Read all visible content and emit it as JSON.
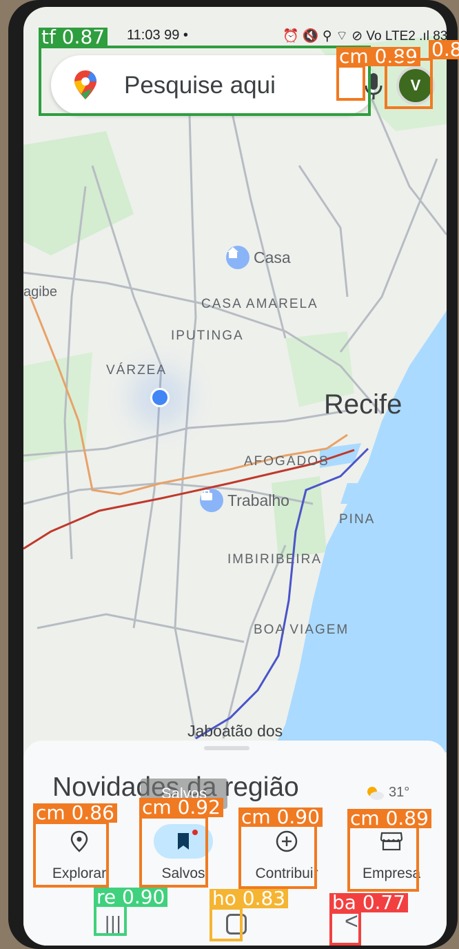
{
  "status_bar": {
    "time": "11:03 99 •",
    "icons": "⏰ 🔇 ⚲ ⌔ ⊘ Vo LTE2 .ıl 83%"
  },
  "search": {
    "placeholder": "Pesquise aqui",
    "mic_icon": "mic-icon",
    "app_icon": "google-maps-pin-icon"
  },
  "account": {
    "avatar_initial": "V"
  },
  "map": {
    "labels": {
      "edge_left": "agibe",
      "casa_amarela": "CASA AMARELA",
      "iputinga": "IPUTINGA",
      "varzea": "VÁRZEA",
      "afogados": "AFOGADOS",
      "pina": "PINA",
      "imbiribeira": "IMBIRIBEIRA",
      "boa_viagem": "BOA VIAGEM",
      "jaboatao": "Jaboatão dos",
      "city": "Recife"
    },
    "pois": [
      {
        "label": "Casa",
        "icon": "home-icon"
      },
      {
        "label": "Trabalho",
        "icon": "briefcase-icon"
      }
    ],
    "colors": {
      "land": "#eef0ec",
      "water": "#aadaff",
      "green": "#d4ecd0",
      "road": "#b7bcc3",
      "rail_orange": "#e8a268",
      "rail_red": "#c0392b",
      "metro_blue": "#4a54c9"
    }
  },
  "bottom_sheet": {
    "title": "Novidades da região",
    "weather": "31°",
    "weather_icon": "partly-cloudy-icon",
    "tooltip": "Salvos"
  },
  "nav": [
    {
      "label": "Explorar",
      "icon": "location-pin-icon",
      "selected": false
    },
    {
      "label": "Salvos",
      "icon": "bookmark-icon",
      "selected": true
    },
    {
      "label": "Contribuir",
      "icon": "add-circle-icon",
      "selected": false
    },
    {
      "label": "Empresa",
      "icon": "storefront-icon",
      "selected": false
    }
  ],
  "system_nav": {
    "recents": "|||",
    "back": "<"
  },
  "detections": [
    {
      "label": "tf 0.87",
      "color": "#2e9e3f"
    },
    {
      "label": "cm 0.89",
      "color": "#f07a22"
    },
    {
      "label": "0.8",
      "color": "#f07a22"
    },
    {
      "label": "cm 0.86",
      "color": "#f07a22"
    },
    {
      "label": "cm 0.92",
      "color": "#f07a22"
    },
    {
      "label": "cm 0.90",
      "color": "#f07a22"
    },
    {
      "label": "cm 0.89",
      "color": "#f07a22"
    },
    {
      "label": "re 0.90",
      "color": "#3fd17d"
    },
    {
      "label": "ho 0.83",
      "color": "#f5b431"
    },
    {
      "label": "ba 0.77",
      "color": "#f24040"
    }
  ]
}
